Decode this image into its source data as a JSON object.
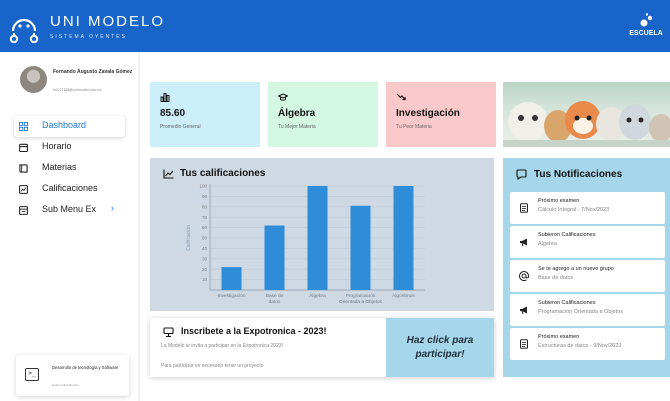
{
  "header": {
    "brand": "UNI MODELO",
    "brand_sub": "SISTEMA OYENTES",
    "school": "ESCUELA"
  },
  "user": {
    "name": "Fernando Augusto Zavala Gómez",
    "email": "fe2271836@unimodelo.edu.mx"
  },
  "nav": [
    {
      "label": "Dashboard",
      "icon": "grid-icon",
      "active": true
    },
    {
      "label": "Horario",
      "icon": "calendar-icon"
    },
    {
      "label": "Materias",
      "icon": "book-icon"
    },
    {
      "label": "Calificaciones",
      "icon": "grades-icon"
    },
    {
      "label": "Sub Menu Ex",
      "icon": "submenu-icon",
      "chevron": "›"
    }
  ],
  "footer": {
    "title": "Desarrollo de tecnología y Software",
    "subtitle": "Universidad Modelo",
    "icon_text": ">_"
  },
  "stats": [
    {
      "value": "85.60",
      "label": "Promedio General",
      "icon": "bar-chart-icon",
      "color": "#cdeefb"
    },
    {
      "value": "Álgebra",
      "label": "Tu Mejor Materia",
      "icon": "graduation-cap-icon",
      "color": "#d3f7e3"
    },
    {
      "value": "Investigación",
      "label": "Tu Peor Materia",
      "icon": "trending-down-icon",
      "color": "#fbc9c9"
    }
  ],
  "chart_title": "Tus calificaciones",
  "chart_data": {
    "type": "bar",
    "categories": [
      "Investigación",
      "Base de datos",
      "Álgebra",
      "Programación Orientada a Objetos",
      "Algoritmos"
    ],
    "tick_labels": [
      [
        "Investigación"
      ],
      [
        "Base de",
        "datos"
      ],
      [
        "Álgebra"
      ],
      [
        "Programación",
        "Orientada a Objetos"
      ],
      [
        "Algoritmos"
      ]
    ],
    "values": [
      22,
      62,
      100,
      81,
      100
    ],
    "ylabel": "Calificación",
    "yticks": [
      10,
      20,
      30,
      40,
      50,
      60,
      70,
      80,
      90,
      100
    ],
    "ylim": [
      0,
      100
    ],
    "bar_color": "#2f8cd8",
    "grid": true
  },
  "expo": {
    "title": "Inscribete a la Expotronica - 2023!",
    "line1": "La Modelo te invita a participar en la Expotronica 2023!",
    "line2": "Para participar es necesario tener un proyecto",
    "cta_line1": "Haz click para",
    "cta_line2": "participar!"
  },
  "notifications_title": "Tus Notificaciones",
  "notifications": [
    {
      "head": "Próximo examen",
      "body": "Cálculo Integral - 7/Nov/2023",
      "icon": "document-icon"
    },
    {
      "head": "Subieron Calificaciones",
      "body": "Algebra",
      "icon": "megaphone-icon"
    },
    {
      "head": "Se te agrego a un nuevo grupo",
      "body": "Base de datos",
      "icon": "at-sign-icon"
    },
    {
      "head": "Subieron Calificaciones",
      "body": "Programación Orientada a Objetos",
      "icon": "megaphone-icon"
    },
    {
      "head": "Próximo examen",
      "body": "Estructuras de datos - 9/Nov/2023",
      "icon": "document-icon"
    }
  ]
}
